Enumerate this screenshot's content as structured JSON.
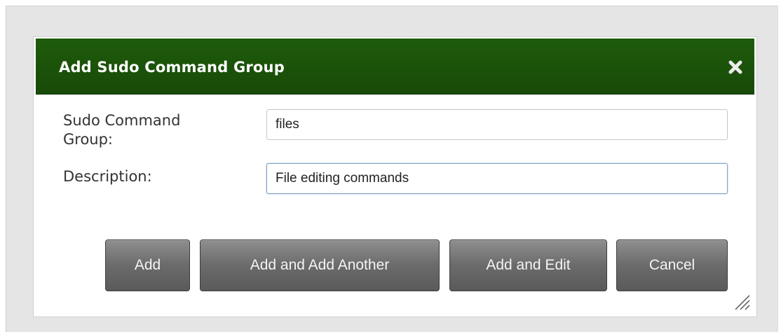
{
  "dialog": {
    "title": "Add Sudo Command Group",
    "close_icon": "close-icon"
  },
  "form": {
    "group_label": "Sudo Command Group:",
    "group_label_line1": "Sudo Command",
    "group_label_line2": "Group:",
    "group_value": "files",
    "description_label": "Description:",
    "description_value": "File editing commands"
  },
  "buttons": {
    "add": "Add",
    "add_another": "Add and Add Another",
    "add_edit": "Add and Edit",
    "cancel": "Cancel"
  },
  "colors": {
    "titlebar": "#1f5c0c",
    "button": "#6b6b6b"
  }
}
